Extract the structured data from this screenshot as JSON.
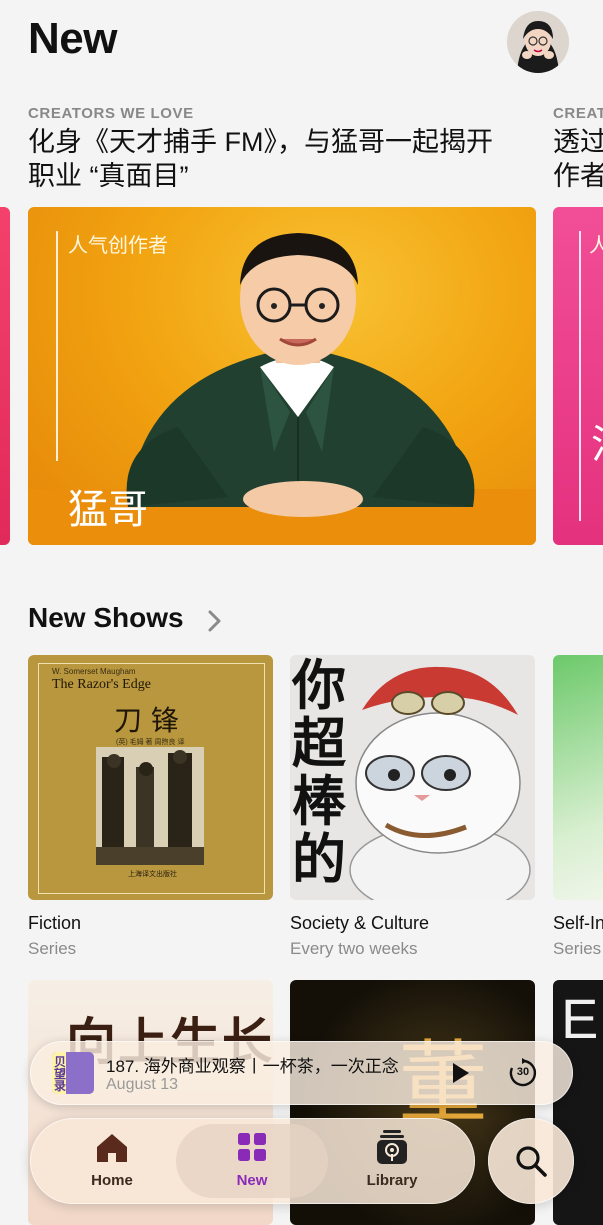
{
  "header": {
    "title": "New"
  },
  "featured": {
    "eyebrow": "CREATORS WE LOVE",
    "title_line1": "化身《天才捕手 FM》，与猛哥一起揭开",
    "title_line2": "职业 “真面目”",
    "badge": "人气创作者",
    "name": "猛哥",
    "next_eyebrow": "CREAT",
    "next_title_line1": "透过",
    "next_title_line2": "作者",
    "next_badge_fragment": "人",
    "next_name_fragment": "泫"
  },
  "new_shows": {
    "title": "New Shows",
    "items": [
      {
        "name": "Fiction",
        "subtitle": "Series",
        "cover_author": "W. Somerset Maugham",
        "cover_title_en": "The Razor's Edge",
        "cover_title_zh": "刀 锋",
        "cover_credit": "(英) 毛姆 著  周煦良 译",
        "cover_publisher": "上海译文出版社"
      },
      {
        "name": "Society & Culture",
        "subtitle": "Every two weeks",
        "cover_text": [
          "你",
          "超",
          "棒",
          "的"
        ]
      },
      {
        "name": "Self-In",
        "subtitle": "Series"
      }
    ],
    "row2_cover1_text": "向上生长",
    "row2_cover2_text": "董",
    "row2_cover3_text": "E"
  },
  "player": {
    "title": "187. 海外商业观察丨一杯茶，一次正念",
    "date": "August 13",
    "art_text": "贝望录",
    "skip_label": "30"
  },
  "tabs": [
    {
      "label": "Home"
    },
    {
      "label": "New"
    },
    {
      "label": "Library"
    }
  ],
  "colors": {
    "accent_purple": "#8a2bb8",
    "home_icon": "#5a2a1c",
    "featured_orange": "#f2a411"
  }
}
